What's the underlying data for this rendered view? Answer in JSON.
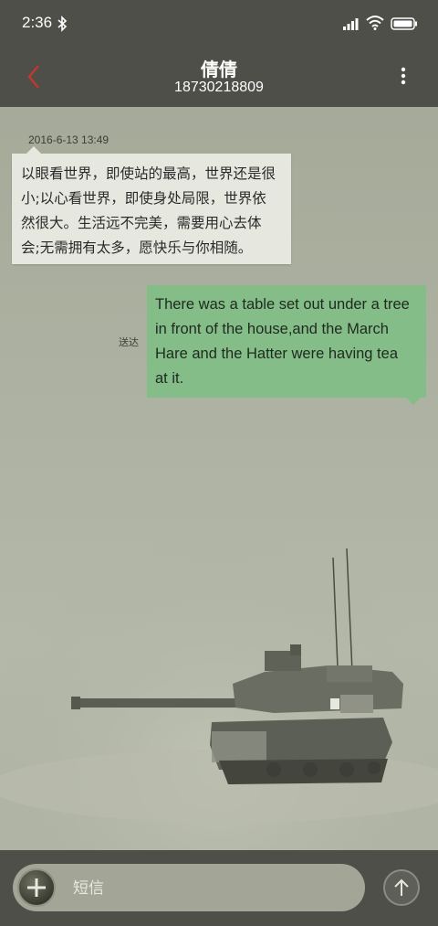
{
  "status_bar": {
    "time": "2:36",
    "icons": [
      "bluetooth-icon",
      "signal-icon",
      "wifi-icon",
      "battery-icon"
    ]
  },
  "header": {
    "contact_name": "倩倩",
    "contact_number": "18730218809",
    "back_icon": "chevron-left-icon",
    "more_icon": "more-vertical-icon",
    "back_color": "#c0392b"
  },
  "messages": [
    {
      "direction": "incoming",
      "timestamp": "2016-6-13 13:49",
      "lines": [
        "以眼看世界，即使站的最高，世界还是很",
        "小;以心看世界，即使身处局限，世界依",
        "然很大。生活远不完美，需要用心去体",
        "会;无需拥有太多，愿快乐与你相随。"
      ]
    },
    {
      "direction": "outgoing",
      "status": "送达",
      "lines": [
        "There was a table set out under a tree",
        "in front of the house,and the March",
        "Hare and the Hatter were having tea",
        "at it."
      ]
    }
  ],
  "compose": {
    "placeholder": "短信",
    "attach_icon": "plus-icon",
    "send_icon": "arrow-up-icon"
  },
  "colors": {
    "bar_background": "#4d4f48",
    "incoming_bubble": "#e6e8df",
    "outgoing_bubble": "#84bd88"
  }
}
